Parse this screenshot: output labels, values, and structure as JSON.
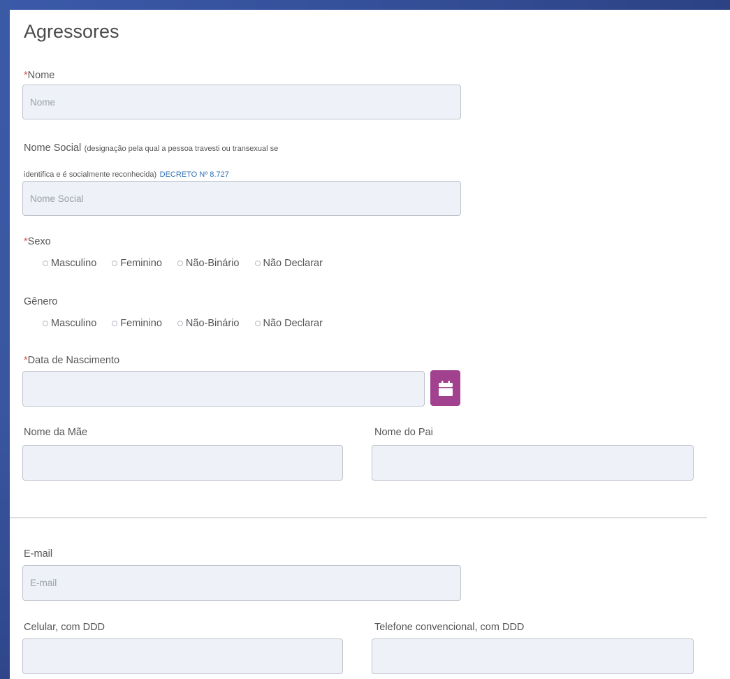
{
  "section": {
    "title": "Agressores"
  },
  "required_mark": "*",
  "nome": {
    "label": "Nome",
    "placeholder": "Nome"
  },
  "nome_social": {
    "label": "Nome Social",
    "hint_line1": "(designação pela qual a pessoa travesti ou transexual se",
    "hint_line2": "identifica e é socialmente reconhecida)",
    "decree_link": "DECRETO Nº 8.727",
    "placeholder": "Nome Social"
  },
  "sexo": {
    "label": "Sexo",
    "options": [
      "Masculino",
      "Feminino",
      "Não-Binário",
      "Não Declarar"
    ]
  },
  "genero": {
    "label": "Gênero",
    "options": [
      "Masculino",
      "Feminino",
      "Não-Binário",
      "Não Declarar"
    ]
  },
  "data_nascimento": {
    "label": "Data de Nascimento",
    "value": "",
    "calendar_icon": "calendar-icon",
    "button_color": "#a2418e"
  },
  "nome_mae": {
    "label": "Nome da Mãe",
    "value": ""
  },
  "nome_pai": {
    "label": "Nome do Pai",
    "value": ""
  },
  "email": {
    "label": "E-mail",
    "placeholder": "E-mail"
  },
  "celular": {
    "label": "Celular, com DDD",
    "value": ""
  },
  "telefone": {
    "label": "Telefone convencional, com DDD",
    "value": ""
  }
}
